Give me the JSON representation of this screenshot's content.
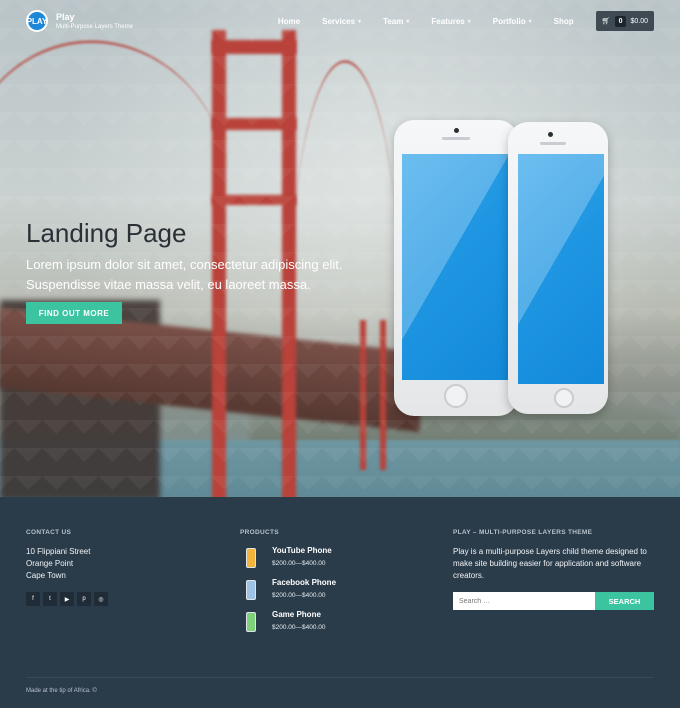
{
  "header": {
    "logo_text": "PLAY",
    "brand_title": "Play",
    "brand_subtitle": "Multi-Purpose Layers Theme",
    "nav": [
      "Home",
      "Services",
      "Team",
      "Features",
      "Portfolio",
      "Shop"
    ],
    "cart_count": "0",
    "cart_total": "$0.00"
  },
  "hero": {
    "title": "Landing Page",
    "text": "Lorem ipsum dolor sit amet, consectetur adipiscing elit. Suspendisse vitae massa velit, eu laoreet massa.",
    "cta_label": "FIND OUT MORE"
  },
  "footer": {
    "contact_title": "CONTACT US",
    "address": [
      "10 Flippiani Street",
      "Orange Point",
      "Cape Town"
    ],
    "social_icons": [
      "facebook-icon",
      "twitter-icon",
      "youtube-icon",
      "pinterest-icon",
      "dribbble-icon"
    ],
    "products_title": "PRODUCTS",
    "products": [
      {
        "name": "YouTube Phone",
        "price": "$200.00—$400.00",
        "color": "#f2b43a"
      },
      {
        "name": "Facebook Phone",
        "price": "$200.00—$400.00",
        "color": "#9cc3e6"
      },
      {
        "name": "Game Phone",
        "price": "$200.00—$400.00",
        "color": "#7ed07a"
      }
    ],
    "about_title": "PLAY – MULTI-PURPOSE LAYERS THEME",
    "about_text": "Play is a multi-purpose Layers child theme designed to make site building easier for application and software creators.",
    "search_placeholder": "Search …",
    "search_button": "SEARCH",
    "copyright": "Made at the tip of Africa. ©"
  },
  "colors": {
    "accent": "#3cc3a0",
    "footer_bg": "#2a3b4a"
  }
}
